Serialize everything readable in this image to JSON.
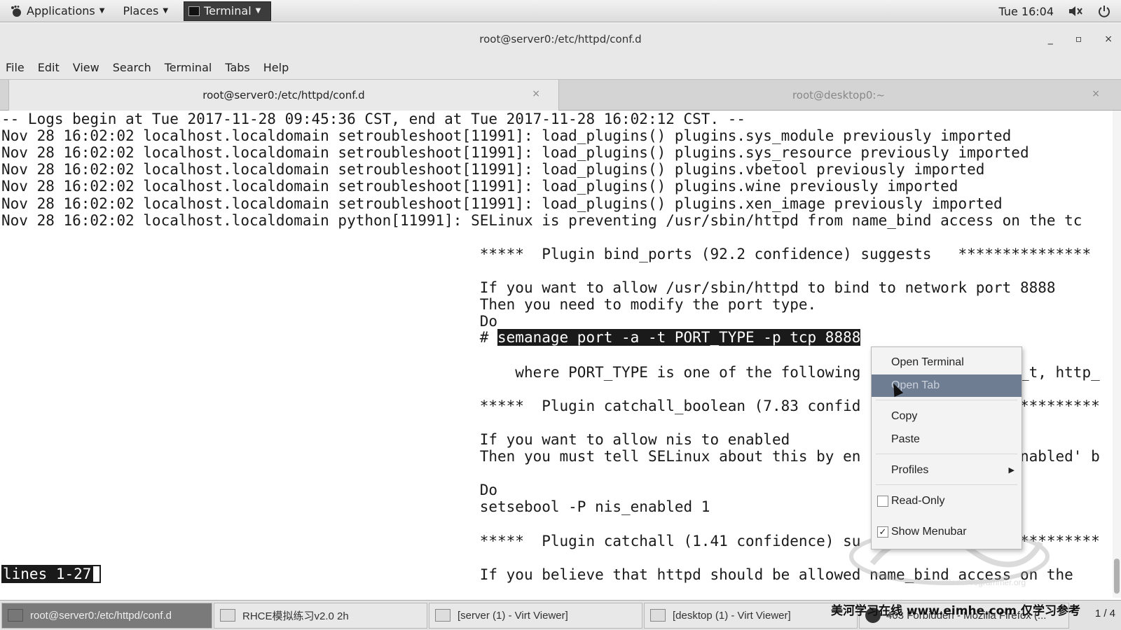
{
  "top_panel": {
    "applications": "Applications",
    "places": "Places",
    "terminal": "Terminal",
    "clock": "Tue 16:04",
    "volume_icon": "speaker-icon",
    "power_icon": "power-icon"
  },
  "window": {
    "title": "root@server0:/etc/httpd/conf.d",
    "minimize": "_",
    "maximize": "▫",
    "close": "×"
  },
  "menubar": [
    "File",
    "Edit",
    "View",
    "Search",
    "Terminal",
    "Tabs",
    "Help"
  ],
  "tabs": [
    {
      "label": "root@server0:/etc/httpd/conf.d",
      "close": "×",
      "active": true
    },
    {
      "label": "root@desktop0:~",
      "close": "×",
      "active": false
    }
  ],
  "terminal": {
    "lines": [
      "-- Logs begin at Tue 2017-11-28 09:45:36 CST, end at Tue 2017-11-28 16:02:12 CST. --",
      "Nov 28 16:02:02 localhost.localdomain setroubleshoot[11991]: load_plugins() plugins.sys_module previously imported",
      "Nov 28 16:02:02 localhost.localdomain setroubleshoot[11991]: load_plugins() plugins.sys_resource previously imported",
      "Nov 28 16:02:02 localhost.localdomain setroubleshoot[11991]: load_plugins() plugins.vbetool previously imported",
      "Nov 28 16:02:02 localhost.localdomain setroubleshoot[11991]: load_plugins() plugins.wine previously imported",
      "Nov 28 16:02:02 localhost.localdomain setroubleshoot[11991]: load_plugins() plugins.xen_image previously imported",
      "Nov 28 16:02:02 localhost.localdomain python[11991]: SELinux is preventing /usr/sbin/httpd from name_bind access on the tc",
      "",
      "                                                      *****  Plugin bind_ports (92.2 confidence) suggests   ***************",
      "",
      "                                                      If you want to allow /usr/sbin/httpd to bind to network port 8888",
      "                                                      Then you need to modify the port type.",
      "                                                      Do",
      "",
      "                                                          where PORT_TYPE is one of the following                  _t, http_",
      "",
      "                                                      *****  Plugin catchall_boolean (7.83 confid                  *********",
      "",
      "                                                      If you want to allow nis to enabled",
      "                                                      Then you must tell SELinux about this by en                  nabled' b",
      "",
      "                                                      Do",
      "                                                      setsebool -P nis_enabled 1",
      "",
      "                                                      *****  Plugin catchall (1.41 confidence) su                  *********",
      "",
      "                                                      If you believe that httpd should be allowed name_bind access on the"
    ],
    "hash_prefix": "                                                      # ",
    "selected_text": "semanage port -a -t PORT_TYPE -p tcp 8888",
    "status": "lines 1-27"
  },
  "context_menu": {
    "items": [
      "Open Terminal",
      "Open Tab",
      "Copy",
      "Paste",
      "Profiles",
      "Read-Only",
      "Show Menubar"
    ],
    "read_only_checked": false,
    "show_menubar_checked": true,
    "highlighted": "Open Tab"
  },
  "watermark": {
    "site": "©CodeProgrammer.org"
  },
  "taskbar": {
    "tasks": [
      "root@server0:/etc/httpd/conf.d",
      "RHCE模拟练习v2.0 2h",
      "[server (1) - Virt Viewer]",
      "[desktop (1) - Virt Viewer]",
      "403 Forbidden - Mozilla Firefox (..."
    ],
    "workspace": "1 / 4",
    "overlay_text": "美河学习在线 www.eimhe.com 仅学习参考"
  }
}
